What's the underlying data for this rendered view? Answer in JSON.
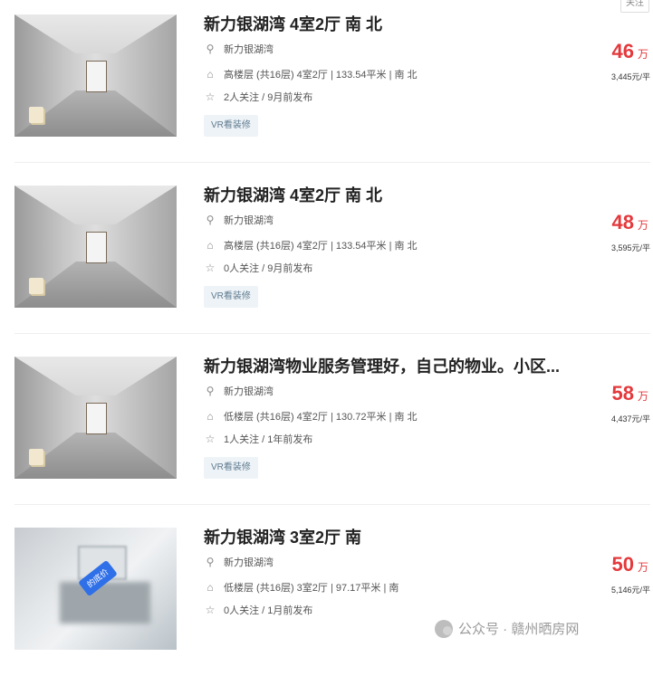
{
  "follow_button": "关注",
  "listings": [
    {
      "title": "新力银湖湾 4室2厅 南 北",
      "community": "新力银湖湾",
      "info": "高楼层 (共16层) 4室2厅 | 133.54平米 | 南 北",
      "follow": "2人关注 / 9月前发布",
      "tag": "VR看装修",
      "price": "46",
      "price_unit": "万",
      "unit_price": "3,445元/平"
    },
    {
      "title": "新力银湖湾 4室2厅 南 北",
      "community": "新力银湖湾",
      "info": "高楼层 (共16层) 4室2厅 | 133.54平米 | 南 北",
      "follow": "0人关注 / 9月前发布",
      "tag": "VR看装修",
      "price": "48",
      "price_unit": "万",
      "unit_price": "3,595元/平"
    },
    {
      "title": "新力银湖湾物业服务管理好，自己的物业。小区...",
      "community": "新力银湖湾",
      "info": "低楼层 (共16层) 4室2厅 | 130.72平米 | 南 北",
      "follow": "1人关注 / 1年前发布",
      "tag": "VR看装修",
      "price": "58",
      "price_unit": "万",
      "unit_price": "4,437元/平"
    },
    {
      "title": "新力银湖湾 3室2厅 南",
      "community": "新力银湖湾",
      "info": "低楼层 (共16层) 3室2厅 | 97.17平米 | 南",
      "follow": "0人关注 / 1月前发布",
      "price": "50",
      "price_unit": "万",
      "unit_price": "5,146元/平",
      "image_badge": "的底价"
    }
  ],
  "watermark": "公众号 · 赣州晒房网",
  "icons": {
    "location": "location-pin-icon",
    "house": "house-icon",
    "star": "star-icon"
  }
}
